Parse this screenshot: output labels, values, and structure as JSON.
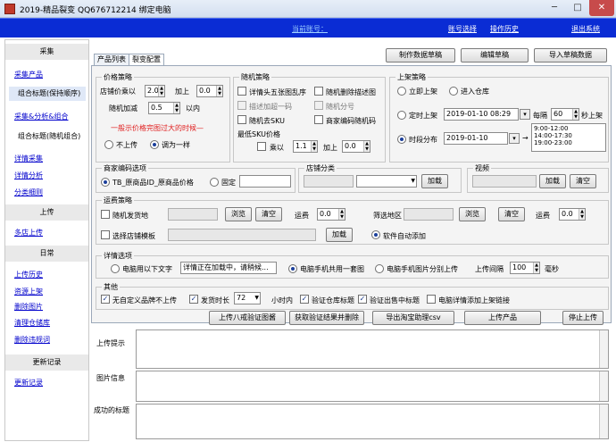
{
  "window": {
    "title": "2019-精品裂变 QQ676712214 绑定电脑",
    "controls": {
      "minimize": "─",
      "maximize": "□",
      "close": "✕"
    }
  },
  "topnav": {
    "current": "当前账号：",
    "links": [
      "账号选择",
      "操作历史",
      "退出系统"
    ]
  },
  "sidebar": {
    "section1": "采集",
    "collect_product": "采集产品",
    "group_title_price": "组合标题(保持顺序)",
    "collect_split_combine": "采集&分析&组合",
    "group_title_random": "组合标题(随机组合)",
    "detail_collect": "详情采集",
    "detail_analysis": "详情分析",
    "category_detail": "分类细则",
    "section2": "上传",
    "upload_manage": "多店上传",
    "section3": "日常",
    "upload_history": "上传历史",
    "shop_upload": "资源上架",
    "delete_images": "删除图片",
    "clear_listing": "清理仓储库",
    "delete_violations": "删除违规词",
    "section4": "更新记录",
    "update_log": "更新记录"
  },
  "toolbar": {
    "make_data_package": "制作数据草稿",
    "edit_draft": "编辑草稿",
    "import_draft": "导入草稿数据"
  },
  "tabs": [
    "产品列表",
    "裂变配置"
  ],
  "price": {
    "group": "价格策略",
    "store_price_times": "店铺价乘以",
    "times_value": "2.0",
    "plus": "加上",
    "plus_value": "0.0",
    "random_add": "随机加减",
    "random_value": "0.5",
    "within": "以内",
    "warning": "一般示价格完图过大的时候—",
    "no_up": "不上传",
    "adjust": "调为一样"
  },
  "random": {
    "group": "随机策略",
    "opt1": "详情头五张图乱序",
    "opt2": "随机删除描述图",
    "opt3": "描述加超一码",
    "opt4": "随机分号",
    "opt5": "随机去SKU",
    "opt6": "商家编码随机码",
    "min_sku": "最低SKU价格",
    "multiply": "乘以",
    "mult_value": "1.1",
    "add": "加上",
    "add_value": "0.0"
  },
  "listing": {
    "group": "上架策略",
    "immediate": "立即上架",
    "warehouse": "进入仓库",
    "scheduled": "定时上架",
    "sched_date": "2019-01-10 08:29",
    "every": "每隔",
    "interval": "60",
    "seconds": "秒上架",
    "time_dist": "时段分布",
    "dist_date": "2019-01-10",
    "slots": [
      "9:00-12:00",
      "14:00-17:30",
      "19:00-23:00"
    ]
  },
  "merchant": {
    "group": "商家编码选项",
    "opt_tb": "TB_原商品ID_原商品价格",
    "opt_fixed": "固定",
    "fixed_value": "",
    "shop_category": "店铺分类",
    "add_btn": "加载",
    "video": "视频",
    "video_add": "加载",
    "video_clear": "清空"
  },
  "shipping": {
    "group": "运费策略",
    "random_ship": "随机发货地",
    "browse1": "浏览",
    "clear1": "清空",
    "fee1": "运费",
    "fee1_value": "0.0",
    "filter_region": "筛选地区",
    "browse2": "浏览",
    "clear2": "清空",
    "fee2": "运费",
    "fee2_value": "0.0",
    "choose_template": "选择店铺模板",
    "load_btn": "加载",
    "auto_add": "软件自动添加"
  },
  "detail": {
    "group": "详情选项",
    "opt1": "电脑用以下文字",
    "text_value": "详情正在加载中，请稍候...",
    "opt2": "电脑手机共用一套图",
    "opt3": "电脑手机图片分别上传",
    "upload_interval": "上传间隔",
    "interval_value": "100",
    "ms": "毫秒"
  },
  "other": {
    "group": "其他",
    "no_custom": "无自定义品牌不上传",
    "ship_time": "发货时长",
    "ship_value": "72",
    "hours": "小时内",
    "verify_title": "验证仓库标题",
    "verify_sold": "验证出售中标题",
    "desktop_detail": "电脑详情添加上架链接"
  },
  "actions": {
    "upload_eight": "上传八戒验证图酱",
    "get_verify": "获取验证结果并删除",
    "export_csv": "导出淘宝助理csv",
    "upload_product": "上传产品",
    "stop_upload": "停止上传"
  },
  "logs": {
    "upload_tip": "上传提示",
    "image_info": "图片信息",
    "success_title": "成功的标题"
  }
}
